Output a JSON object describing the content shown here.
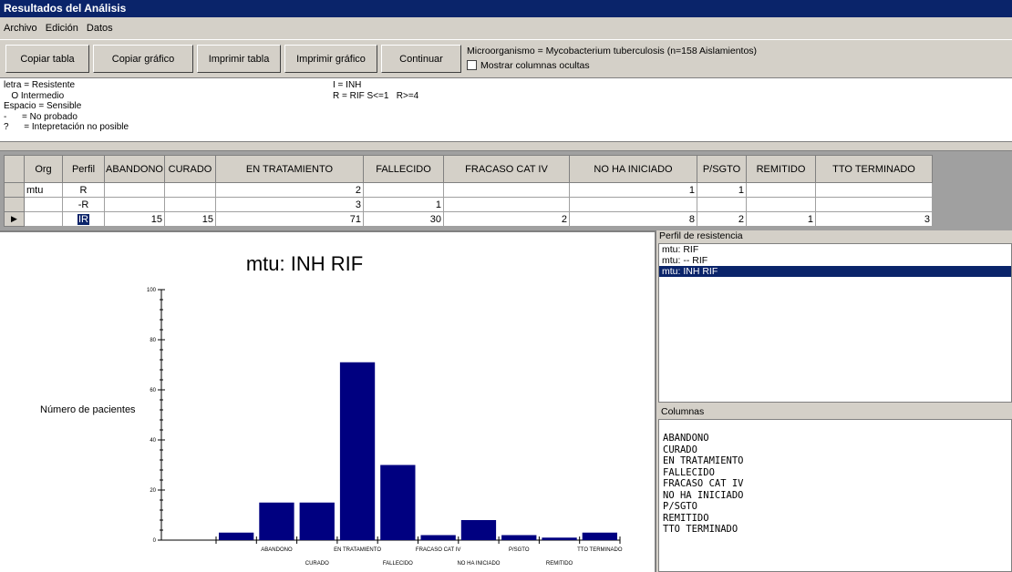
{
  "window": {
    "title": "Resultados del Análisis"
  },
  "menu": [
    "Archivo",
    "Edición",
    "Datos"
  ],
  "toolbar": {
    "copy_table": "Copiar tabla",
    "copy_chart": "Copiar gráfico",
    "print_table": "Imprimir tabla",
    "print_chart": "Imprimir gráfico",
    "continue": "Continuar",
    "info": "Microorganismo = Mycobacterium tuberculosis   (n=158 Aislamientos)",
    "show_hidden_label": "Mostrar columnas ocultas"
  },
  "legend": {
    "left": [
      "letra = Resistente",
      "   O Intermedio",
      "Espacio = Sensible",
      "-      = No probado",
      "?      = Intepretación no posible"
    ],
    "right": [
      "I = INH",
      "R = RIF S<=1   R>=4"
    ]
  },
  "grid": {
    "headers": [
      "Org",
      "Perfil",
      "ABANDONO",
      "CURADO",
      "EN TRATAMIENTO",
      "FALLECIDO",
      "FRACASO CAT IV",
      "NO HA INICIADO",
      "P/SGTO",
      "REMITIDO",
      "TTO TERMINADO"
    ],
    "rows": [
      {
        "org": "mtu",
        "perfil": "R",
        "values": [
          "",
          "",
          "2",
          "",
          "",
          "1",
          "1",
          "",
          ""
        ]
      },
      {
        "org": "",
        "perfil": "-R",
        "values": [
          "",
          "",
          "3",
          "1",
          "",
          "",
          "",
          "",
          ""
        ]
      },
      {
        "org": "",
        "perfil": "IR",
        "values": [
          "15",
          "15",
          "71",
          "30",
          "2",
          "8",
          "2",
          "1",
          "3"
        ]
      }
    ],
    "current_row_marker": "▶"
  },
  "chart_data": {
    "type": "bar",
    "title": "mtu: INH RIF",
    "ylabel": "Número de pacientes",
    "xlabel": "",
    "ylim": [
      0,
      100
    ],
    "yticks": [
      0,
      20,
      40,
      60,
      80,
      100
    ],
    "categories": [
      "",
      "ABANDONO",
      "CURADO",
      "EN TRATAMIENTO",
      "FALLECIDO",
      "FRACASO CAT IV",
      "NO HA INICIADO",
      "P/SGTO",
      "REMITIDO",
      "TTO TERMINADO"
    ],
    "values": [
      3,
      15,
      15,
      71,
      30,
      2,
      8,
      2,
      1,
      3
    ],
    "bar_color": "#000080",
    "grid": false,
    "legend": "none"
  },
  "right_panel": {
    "perfil_title": "Perfil de resistencia",
    "perfil_items": [
      "mtu: RIF",
      "mtu: -- RIF",
      "mtu: INH RIF"
    ],
    "perfil_selected_index": 2,
    "columnas_title": "Columnas",
    "columnas_items": [
      "ABANDONO",
      "CURADO",
      "EN TRATAMIENTO",
      "FALLECIDO",
      "FRACASO CAT IV",
      "NO HA INICIADO",
      "P/SGTO",
      "REMITIDO",
      "TTO TERMINADO"
    ]
  }
}
